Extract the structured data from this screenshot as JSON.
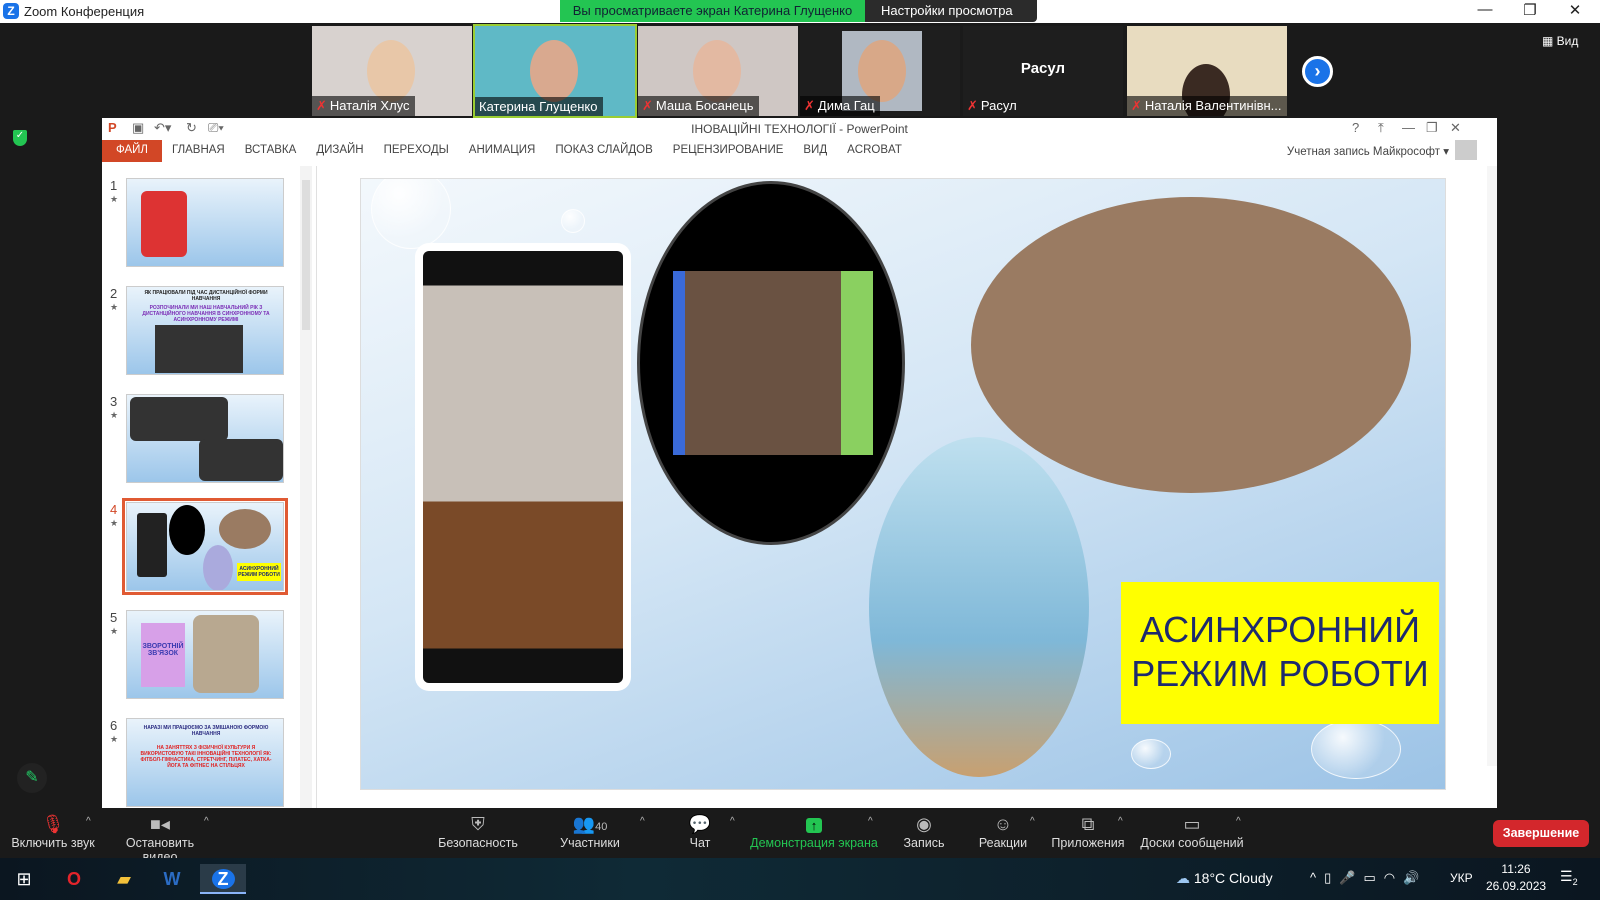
{
  "window": {
    "title": "Zoom Конференция",
    "logo": "Z"
  },
  "banner": {
    "text": "Вы просматриваете экран Катерина Глущенко",
    "settings": "Настройки просмотра"
  },
  "view_button": "Вид",
  "participants": [
    {
      "name": "Наталія Хлус",
      "muted": true,
      "video": true
    },
    {
      "name": "Катерина Глущенко",
      "muted": false,
      "video": true,
      "active": true
    },
    {
      "name": "Маша Босанець",
      "muted": true,
      "video": true
    },
    {
      "name": "Дима Гац",
      "muted": true,
      "video": true
    },
    {
      "name": "Расул",
      "muted": true,
      "video": false,
      "big_label": "Расул"
    },
    {
      "name": "Наталія Валентинівн...",
      "muted": true,
      "video": true
    }
  ],
  "ppt": {
    "title": "ІНОВАЦІЙНІ ТЕХНОЛОГІЇ - PowerPoint",
    "tabs": [
      "ФАЙЛ",
      "ГЛАВНАЯ",
      "ВСТАВКА",
      "ДИЗАЙН",
      "ПЕРЕХОДЫ",
      "АНИМАЦИЯ",
      "ПОКАЗ СЛАЙДОВ",
      "РЕЦЕНЗИРОВАНИЕ",
      "ВИД",
      "ACROBAT"
    ],
    "account": "Учетная запись Майкрософт",
    "thumbs": [
      {
        "num": "1",
        "text": ""
      },
      {
        "num": "2",
        "text": "ЯК ПРАЦЮВАЛИ ПІД ЧАС ДИСТАНЦІЙНОЇ ФОРМИ НАВЧАННЯ",
        "text2": "РОЗПОЧИНАЛИ МИ НАШ НАВЧАЛЬНИЙ РІК З ДИСТАНЦІЙНОГО НАВЧАННЯ В СИНХРОННОМУ ТА АСИНХРОННОМУ РЕЖИМІ"
      },
      {
        "num": "3",
        "text": ""
      },
      {
        "num": "4",
        "text": "АСИНХРОННИЙ РЕЖИМ РОБОТИ",
        "selected": true
      },
      {
        "num": "5",
        "text": "ЗВОРОТНІЙ ЗВ'ЯЗОК"
      },
      {
        "num": "6",
        "text": "НАРАЗІ МИ ПРАЦЮЄМО ЗА ЗМІШАНОЮ ФОРМОЮ НАВЧАННЯ",
        "text2": "НА ЗАНЯТТЯХ З ФІЗИЧНОЇ КУЛЬТУРИ Я ВИКОРИСТОВУЮ ТАКІ ІННОВАЦІЙНІ ТЕХНОЛОГІЇ ЯК: ФІТБОЛ-ГІМНАСТИКА, СТРЕТЧИНГ, ПІЛАТЕС, ХАТКА-ЙОГА ТА ФІТНЕС НА СТІЛЬЦЯХ"
      }
    ],
    "slide": {
      "line1": "АСИНХРОННИЙ",
      "line2": "РЕЖИМ РОБОТИ"
    }
  },
  "toolbar": {
    "unmute": "Включить звук",
    "stop_video": "Остановить видео",
    "security": "Безопасность",
    "participants": "Участники",
    "participants_count": "40",
    "chat": "Чат",
    "share": "Демонстрация экрана",
    "record": "Запись",
    "reactions": "Реакции",
    "apps": "Приложения",
    "whiteboards": "Доски сообщений",
    "end": "Завершение"
  },
  "taskbar": {
    "weather": "18°C  Cloudy",
    "lang": "УКР",
    "time": "11:26",
    "date": "26.09.2023",
    "notifications": "2"
  },
  "colors": {
    "zoom_blue": "#1a73e8",
    "green": "#23c552",
    "ppt_red": "#d24726",
    "end_red": "#d3272c",
    "slide_yellow": "#ffff00"
  }
}
